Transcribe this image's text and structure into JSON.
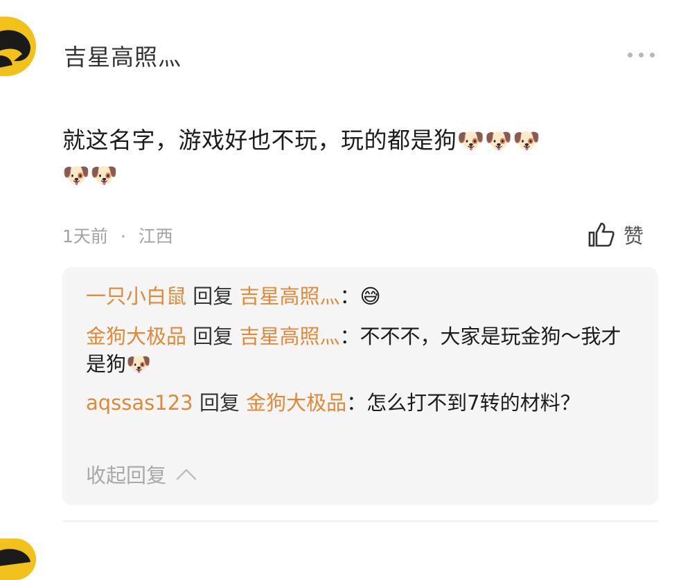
{
  "post": {
    "username": "吉星高照灬",
    "text": "就这名字，游戏好也不玩，玩的都是狗",
    "emoji_line1": "🐶🐶🐶",
    "emoji_line2": "🐶🐶",
    "time": "1天前",
    "separator": "·",
    "location": "江西",
    "like_label": "赞"
  },
  "replies": [
    {
      "from": "一只小白鼠",
      "verb": "回复",
      "to": "吉星高照灬",
      "colon": "：",
      "text": "😅"
    },
    {
      "from": "金狗大极品",
      "verb": "回复",
      "to": "吉星高照灬",
      "colon": "：",
      "text": "不不不，大家是玩金狗～我才是狗🐶"
    },
    {
      "from": "aqssas123",
      "verb": "回复",
      "to": "金狗大极品",
      "colon": "：",
      "text": "怎么打不到7转的材料？"
    }
  ],
  "collapse_label": "收起回复",
  "colors": {
    "username_accent": "#e08937",
    "reply_bg": "#f5f5f5",
    "avatar": "#f3c11b"
  },
  "icons": [
    "more-icon",
    "thumbs-up-icon",
    "chevron-up-icon"
  ]
}
